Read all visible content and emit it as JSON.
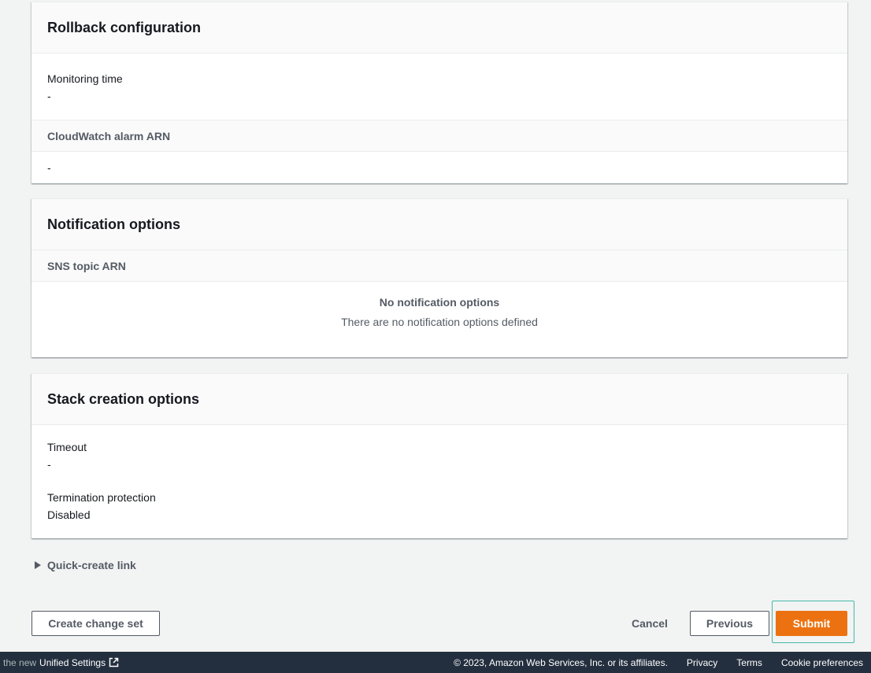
{
  "rollback": {
    "title": "Rollback configuration",
    "monitoring_time_label": "Monitoring time",
    "monitoring_time_value": "-",
    "alarm_header": "CloudWatch alarm ARN",
    "alarm_value": "-"
  },
  "notification": {
    "title": "Notification options",
    "sns_header": "SNS topic ARN",
    "empty_title": "No notification options",
    "empty_desc": "There are no notification options defined"
  },
  "stack_creation": {
    "title": "Stack creation options",
    "timeout_label": "Timeout",
    "timeout_value": "-",
    "termination_label": "Termination protection",
    "termination_value": "Disabled"
  },
  "quick_create": {
    "label": "Quick-create link",
    "icon": "caret-right-icon"
  },
  "actions": {
    "create_change_set": "Create change set",
    "cancel": "Cancel",
    "previous": "Previous",
    "submit": "Submit"
  },
  "footer": {
    "prefix": "the new",
    "unified_settings": "Unified Settings",
    "copyright": "© 2023, Amazon Web Services, Inc. or its affiliates.",
    "privacy": "Privacy",
    "terms": "Terms",
    "cookie_preferences": "Cookie preferences"
  },
  "colors": {
    "primary": "#ec7211",
    "footer_bg": "#232f3e",
    "page_bg": "#f2f3f3",
    "focus": "#44b9a8"
  }
}
